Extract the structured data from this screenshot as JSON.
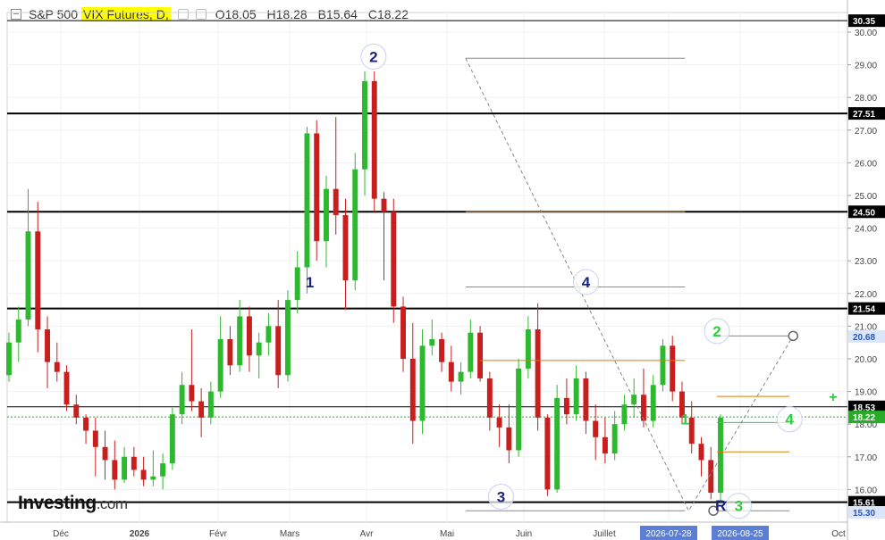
{
  "header": {
    "title": "S&P 500",
    "instrument": "VIX Futures, D,",
    "ohlc": {
      "open": "O18.05",
      "high": "H18.28",
      "low": "B15.64",
      "close": "C18.22"
    }
  },
  "logo": {
    "brand": "Investing",
    "domain": ".com"
  },
  "colors": {
    "up": "#2db92d",
    "down": "#c81e1e",
    "accent_label": "#2962ff",
    "current_price": "#27ae27"
  },
  "chart_data": {
    "type": "candlestick",
    "ylim": [
      15.0,
      30.6
    ],
    "y_ticks": [
      "16.00",
      "17.00",
      "18.00",
      "19.00",
      "20.00",
      "21.00",
      "22.00",
      "23.00",
      "24.00",
      "25.00",
      "26.00",
      "27.00",
      "28.00",
      "29.00",
      "30.00"
    ],
    "x_ticks": [
      "Déc",
      "2026",
      "Févr",
      "Mars",
      "Avr",
      "Mai",
      "Juin",
      "Juillet",
      "2026-07-28",
      "2026-08-25",
      "Oct"
    ],
    "highlighted_x_labels": [
      "2026-07-28",
      "2026-08-25"
    ],
    "horizontal_levels": [
      {
        "label": "30.35",
        "value": 30.35
      },
      {
        "label": "27.51",
        "value": 27.51
      },
      {
        "label": "24.50",
        "value": 24.5
      },
      {
        "label": "21.54",
        "value": 21.54
      },
      {
        "label": "18.53",
        "value": 18.53
      },
      {
        "label": "15.61",
        "value": 15.61
      }
    ],
    "price_badges": [
      {
        "label": "20.68",
        "value": 20.68,
        "style": "blue"
      },
      {
        "label": "18.22",
        "value": 18.22,
        "style": "green"
      },
      {
        "label": "15.30",
        "value": 15.3,
        "style": "blue"
      }
    ],
    "current_price": 18.22,
    "candles": [
      [
        19.5,
        20.8,
        19.3,
        20.5
      ],
      [
        20.5,
        21.6,
        19.9,
        21.2
      ],
      [
        21.2,
        25.2,
        21.0,
        23.9
      ],
      [
        23.9,
        24.8,
        20.2,
        20.9
      ],
      [
        20.9,
        21.3,
        19.1,
        19.9
      ],
      [
        19.9,
        20.5,
        19.3,
        19.6
      ],
      [
        19.6,
        19.8,
        18.4,
        18.6
      ],
      [
        18.6,
        18.9,
        18.0,
        18.2
      ],
      [
        18.2,
        18.3,
        17.4,
        17.8
      ],
      [
        17.8,
        18.2,
        16.4,
        17.3
      ],
      [
        17.3,
        17.8,
        16.3,
        16.9
      ],
      [
        16.9,
        17.5,
        16.0,
        16.3
      ],
      [
        16.3,
        17.3,
        16.2,
        17.0
      ],
      [
        17.0,
        17.3,
        16.4,
        16.6
      ],
      [
        16.6,
        17.0,
        16.1,
        16.3
      ],
      [
        16.3,
        17.2,
        16.1,
        16.4
      ],
      [
        16.4,
        17.1,
        16.0,
        16.8
      ],
      [
        16.8,
        18.5,
        16.6,
        18.3
      ],
      [
        18.3,
        19.6,
        18.0,
        19.2
      ],
      [
        19.2,
        20.9,
        18.4,
        18.7
      ],
      [
        18.7,
        19.1,
        17.6,
        18.2
      ],
      [
        18.2,
        19.3,
        18.0,
        19.0
      ],
      [
        19.0,
        21.3,
        18.8,
        20.6
      ],
      [
        20.6,
        21.0,
        19.5,
        19.8
      ],
      [
        19.8,
        21.8,
        19.6,
        21.3
      ],
      [
        21.3,
        21.6,
        19.6,
        20.1
      ],
      [
        20.1,
        20.8,
        19.4,
        20.5
      ],
      [
        20.5,
        21.4,
        20.1,
        21.0
      ],
      [
        21.0,
        21.8,
        19.1,
        19.5
      ],
      [
        19.5,
        22.1,
        19.3,
        21.8
      ],
      [
        21.8,
        23.3,
        21.4,
        22.8
      ],
      [
        22.8,
        27.1,
        22.0,
        26.9
      ],
      [
        26.9,
        27.3,
        23.0,
        23.6
      ],
      [
        23.6,
        25.6,
        22.8,
        25.2
      ],
      [
        25.2,
        27.4,
        23.8,
        24.4
      ],
      [
        24.4,
        24.9,
        21.5,
        22.4
      ],
      [
        22.4,
        26.3,
        22.1,
        25.8
      ],
      [
        25.8,
        28.8,
        25.0,
        28.5
      ],
      [
        28.5,
        28.8,
        24.5,
        24.9
      ],
      [
        24.9,
        25.1,
        22.4,
        24.5
      ],
      [
        24.5,
        24.9,
        21.1,
        21.6
      ],
      [
        21.6,
        21.9,
        19.6,
        20.0
      ],
      [
        20.0,
        21.1,
        17.4,
        18.1
      ],
      [
        18.1,
        20.9,
        17.7,
        20.4
      ],
      [
        20.4,
        21.2,
        20.1,
        20.6
      ],
      [
        20.6,
        20.8,
        19.6,
        19.9
      ],
      [
        19.9,
        20.4,
        19.0,
        19.3
      ],
      [
        19.3,
        19.9,
        18.9,
        19.6
      ],
      [
        19.6,
        21.2,
        19.4,
        20.8
      ],
      [
        20.8,
        21.0,
        19.3,
        19.4
      ],
      [
        19.4,
        19.6,
        17.8,
        18.2
      ],
      [
        18.2,
        18.6,
        17.3,
        17.9
      ],
      [
        17.9,
        18.6,
        16.8,
        17.2
      ],
      [
        17.2,
        20.0,
        17.0,
        19.7
      ],
      [
        19.7,
        21.3,
        19.4,
        20.9
      ],
      [
        20.9,
        21.7,
        17.8,
        18.2
      ],
      [
        18.2,
        18.3,
        15.8,
        16.0
      ],
      [
        16.0,
        19.2,
        15.9,
        18.8
      ],
      [
        18.8,
        19.4,
        18.0,
        18.3
      ],
      [
        18.3,
        19.8,
        18.1,
        19.4
      ],
      [
        19.4,
        19.6,
        17.7,
        18.1
      ],
      [
        18.1,
        18.6,
        16.9,
        17.6
      ],
      [
        17.6,
        18.2,
        16.8,
        17.1
      ],
      [
        17.1,
        18.4,
        16.9,
        18.0
      ],
      [
        18.0,
        18.9,
        17.8,
        18.6
      ],
      [
        18.6,
        19.4,
        18.2,
        18.9
      ],
      [
        18.9,
        19.7,
        17.9,
        18.1
      ],
      [
        18.1,
        19.5,
        17.9,
        19.2
      ],
      [
        19.2,
        20.6,
        19.0,
        20.4
      ],
      [
        20.4,
        20.7,
        18.7,
        19.0
      ],
      [
        19.0,
        19.3,
        18.0,
        18.2
      ],
      [
        18.2,
        18.7,
        17.1,
        17.4
      ],
      [
        17.4,
        17.6,
        16.4,
        16.9
      ],
      [
        16.9,
        17.3,
        15.7,
        15.9
      ],
      [
        15.9,
        18.3,
        15.6,
        18.2
      ]
    ],
    "annotations": {
      "labels": [
        {
          "text": "1",
          "x": 0.425,
          "y": 22.35,
          "color": "#1a237e",
          "circled": false
        },
        {
          "text": "2",
          "x": 0.515,
          "y": 29.25,
          "color": "#1a237e",
          "circled": true
        },
        {
          "text": "3",
          "x": 0.695,
          "y": 15.78,
          "color": "#1a237e",
          "circled": true
        },
        {
          "text": "4",
          "x": 0.815,
          "y": 22.35,
          "color": "#1a237e",
          "circled": true
        },
        {
          "text": "1",
          "x": 0.955,
          "y": 18.15,
          "color": "#2ecc40",
          "circled": false
        },
        {
          "text": "2",
          "x": 1.0,
          "y": 20.85,
          "color": "#2ecc40",
          "circled": true
        },
        {
          "text": "3",
          "x": 1.03,
          "y": 15.5,
          "color": "#2ecc40",
          "circled": true
        },
        {
          "text": "4",
          "x": 1.1,
          "y": 18.15,
          "color": "#2ecc40",
          "circled": true
        },
        {
          "text": "R",
          "x": 1.005,
          "y": 15.52,
          "color": "#1a237e",
          "circled": false
        },
        {
          "text": "+",
          "x": 1.16,
          "y": 18.85,
          "color": "#2ecc40",
          "circled": false
        }
      ],
      "dashed_path": [
        [
          0.645,
          29.2
        ],
        [
          0.96,
          15.35
        ],
        [
          1.105,
          20.7
        ]
      ],
      "segments": [
        {
          "x1": 0.645,
          "x2": 0.955,
          "y": 29.2,
          "color": "#888888"
        },
        {
          "x1": 0.645,
          "x2": 0.955,
          "y": 24.5,
          "color": "#e07b00"
        },
        {
          "x1": 0.645,
          "x2": 0.955,
          "y": 22.2,
          "color": "#2ecc40"
        },
        {
          "x1": 0.665,
          "x2": 0.955,
          "y": 19.95,
          "color": "#e07b00"
        },
        {
          "x1": 0.645,
          "x2": 0.955,
          "y": 15.35,
          "color": "#888888"
        },
        {
          "x1": 1.0,
          "x2": 1.105,
          "y": 20.7,
          "color": "#888888"
        },
        {
          "x1": 1.0,
          "x2": 1.1,
          "y": 18.85,
          "color": "#e07b00"
        },
        {
          "x1": 1.0,
          "x2": 1.1,
          "y": 18.05,
          "color": "#2ecc40"
        },
        {
          "x1": 1.0,
          "x2": 1.1,
          "y": 17.15,
          "color": "#e07b00"
        },
        {
          "x1": 1.0,
          "x2": 1.1,
          "y": 15.35,
          "color": "#888888"
        }
      ],
      "hollow_points": [
        [
          0.995,
          15.35
        ],
        [
          1.105,
          20.7
        ]
      ]
    }
  }
}
